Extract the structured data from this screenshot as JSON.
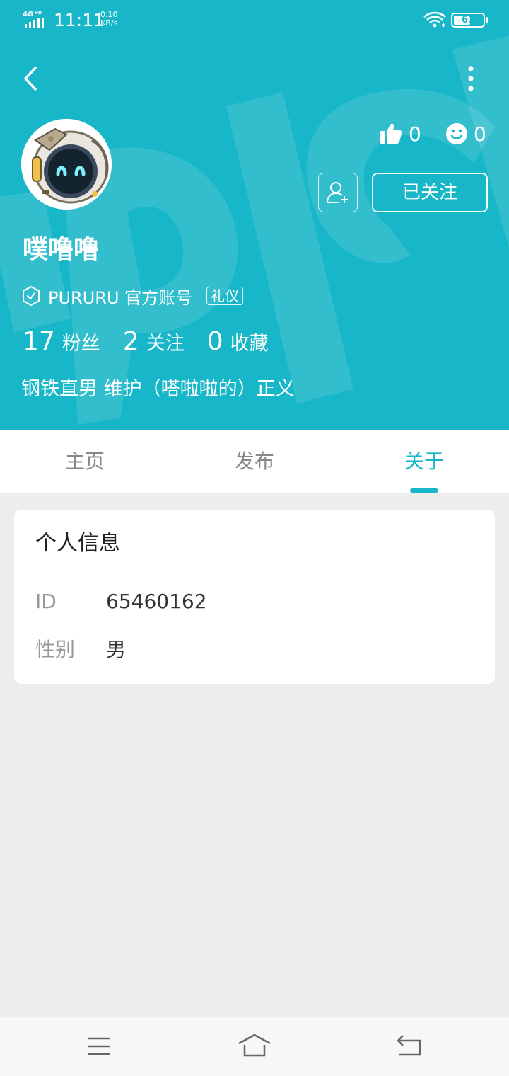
{
  "status_bar": {
    "network": "4G",
    "network_sup": "HD",
    "time": "11:11",
    "speed_value": "0.10",
    "speed_unit": "KB/s",
    "battery": "61",
    "battery_level": 0.61
  },
  "colors": {
    "accent": "#17b6c8",
    "header_bg": "#17b6c8",
    "page_bg": "#ededed"
  },
  "profile": {
    "name": "噗噜噜",
    "official_label": "PURURU 官方账号",
    "badge": "礼仪",
    "likes": "0",
    "reactions": "0",
    "follow_label": "已关注",
    "bio": "钢铁直男 维护（嗒啦啦的）正义",
    "counts": [
      {
        "value": "17",
        "label": "粉丝"
      },
      {
        "value": "2",
        "label": "关注"
      },
      {
        "value": "0",
        "label": "收藏"
      }
    ]
  },
  "tabs": [
    {
      "label": "主页",
      "active": false
    },
    {
      "label": "发布",
      "active": false
    },
    {
      "label": "关于",
      "active": true
    }
  ],
  "info_card": {
    "title": "个人信息",
    "rows": [
      {
        "label": "ID",
        "value": "65460162"
      },
      {
        "label": "性别",
        "value": "男"
      }
    ]
  },
  "icons": {
    "back": "chevron-left-icon",
    "more": "more-vertical-icon",
    "like": "thumbs-up-icon",
    "reaction": "smiley-icon",
    "add_friend": "add-user-icon",
    "verified": "verified-shield-icon",
    "menu": "menu-icon",
    "home": "home-icon",
    "return": "return-icon"
  }
}
